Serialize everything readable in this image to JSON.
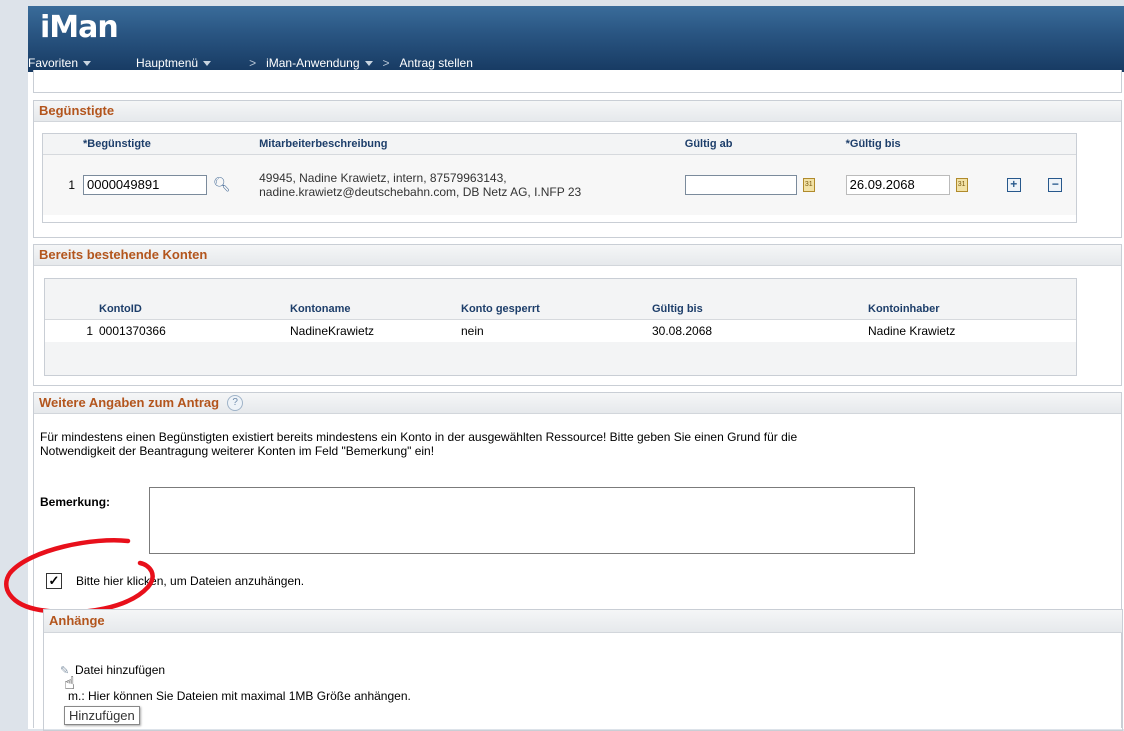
{
  "app": {
    "logo_text": "iMan"
  },
  "nav": {
    "favoriten": "Favoriten",
    "hauptmenu": "Hauptmenü",
    "anwendung": "iMan-Anwendung",
    "current": "Antrag stellen",
    "separator": ">"
  },
  "beguenstigte": {
    "title": "Begünstigte",
    "columns": [
      "*Begünstigte",
      "Mitarbeiterbeschreibung",
      "Gültig ab",
      "*Gültig bis"
    ],
    "row": {
      "index": "1",
      "id_value": "0000049891",
      "description": "49945, Nadine Krawietz, intern, 87579963143, nadine.krawietz@deutschebahn.com, DB Netz AG, I.NFP 23",
      "gueltig_ab": "",
      "gueltig_bis": "26.09.2068"
    },
    "add_label": "+",
    "remove_label": "−"
  },
  "konten": {
    "title": "Bereits bestehende Konten",
    "columns": [
      "KontoID",
      "Kontoname",
      "Konto gesperrt",
      "Gültig bis",
      "Kontoinhaber"
    ],
    "rows": [
      {
        "index": "1",
        "konto_id": "0001370366",
        "kontoname": "NadineKrawietz",
        "gesperrt": "nein",
        "gueltig_bis": "30.08.2068",
        "inhaber": "Nadine Krawietz"
      }
    ]
  },
  "weitere": {
    "title": "Weitere Angaben zum Antrag",
    "help_icon": "?",
    "message": "Für mindestens einen Begünstigten existiert bereits mindestens ein Konto in der ausgewählten Ressource! Bitte geben Sie einen Grund für die Notwendigkeit der Beantragung weiterer Konten im Feld \"Bemerkung\" ein!",
    "bemerkung_label": "Bemerkung:",
    "bemerkung_value": "",
    "checkbox_checked": true,
    "checkbox_mark": "✓",
    "checkbox_label": "Bitte hier klicken, um Dateien anzuhängen."
  },
  "anhaenge": {
    "title": "Anhänge",
    "add_file": "Datei hinzufügen",
    "hint": "m.: Hier können Sie Dateien mit maximal 1MB Größe anhängen.",
    "tooltip": "Hinzufügen"
  },
  "colors": {
    "header_blue": "#234b78",
    "section_title": "#b3551d",
    "annotation_red": "#e8101b"
  }
}
